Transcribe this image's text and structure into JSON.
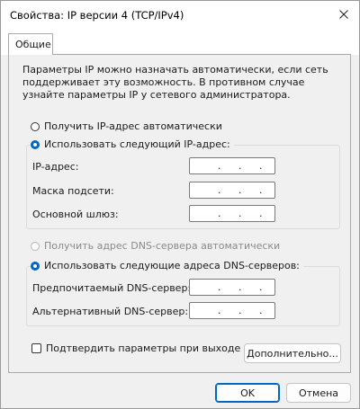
{
  "window": {
    "title": "Свойства: IP версии 4 (TCP/IPv4)",
    "close_icon": "✕"
  },
  "tabs": [
    {
      "label": "Общие",
      "active": true
    }
  ],
  "description": "Параметры IP можно назначать автоматически, если сеть поддерживает эту возможность. В противном случае узнайте параметры IP у сетевого администратора.",
  "ip_section": {
    "auto_label": "Получить IP-адрес автоматически",
    "manual_label": "Использовать следующий IP-адрес:",
    "selected": "manual",
    "fields": [
      {
        "label": "IP-адрес:",
        "value": ". . ."
      },
      {
        "label": "Маска подсети:",
        "value": ". . ."
      },
      {
        "label": "Основной шлюз:",
        "value": ". . ."
      }
    ]
  },
  "dns_section": {
    "auto_label": "Получить адрес DNS-сервера автоматически",
    "manual_label": "Использовать следующие адреса DNS-серверов:",
    "selected": "manual",
    "auto_disabled": true,
    "fields": [
      {
        "label": "Предпочитаемый DNS-сервер:",
        "value": ". . ."
      },
      {
        "label": "Альтернативный DNS-сервер:",
        "value": ". . ."
      }
    ]
  },
  "validate_on_exit": {
    "label": "Подтвердить параметры при выходе",
    "checked": false
  },
  "buttons": {
    "advanced": "Дополнительно...",
    "ok": "OK",
    "cancel": "Отмена"
  },
  "colors": {
    "accent": "#0067c0",
    "window_bg": "#f0f0f0",
    "title_bg": "#ffffff"
  }
}
